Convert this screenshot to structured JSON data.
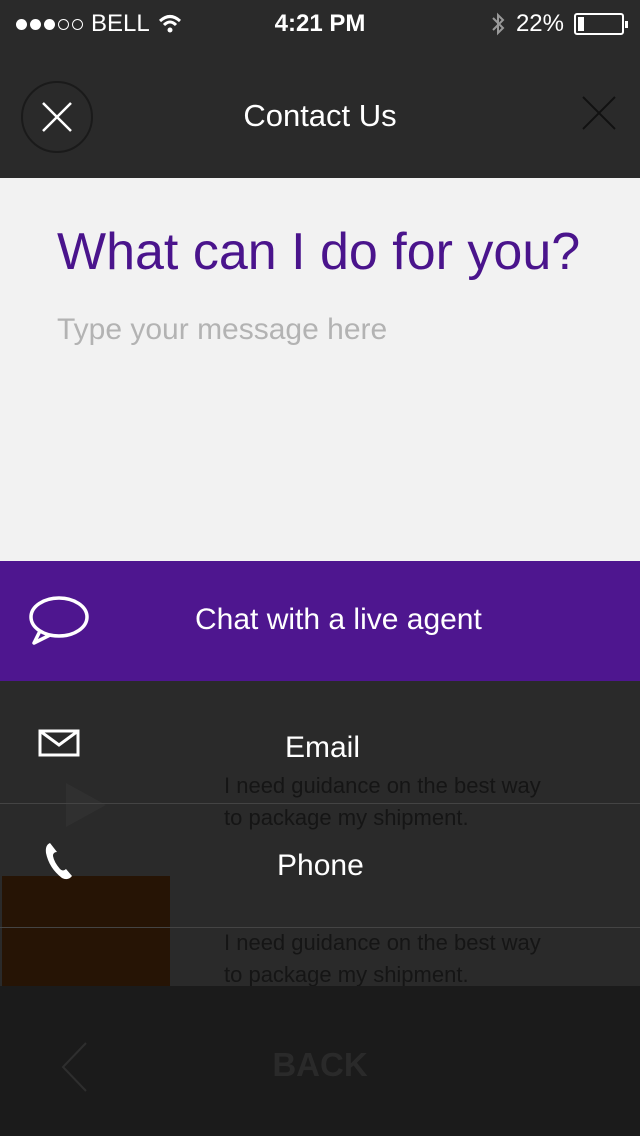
{
  "status_bar": {
    "carrier": "BELL",
    "time": "4:21 PM",
    "battery": "22%",
    "battery_level": 0.22
  },
  "header": {
    "title": "Contact Us"
  },
  "compose": {
    "question": "What can I do for you?",
    "placeholder": "Type your message here"
  },
  "chat_button": {
    "label": "Chat with a live agent"
  },
  "options": [
    {
      "label": "Email",
      "icon": "envelope-icon",
      "ghost_text": "I need guidance on the best way to package my shipment."
    },
    {
      "label": "Phone",
      "icon": "phone-icon",
      "ghost_text": "I need guidance on the best way to package my shipment."
    }
  ],
  "footer": {
    "back_label": "BACK"
  },
  "colors": {
    "accent": "#4e168f",
    "question_text": "#4a148c",
    "dark": "#2a2a2a"
  }
}
